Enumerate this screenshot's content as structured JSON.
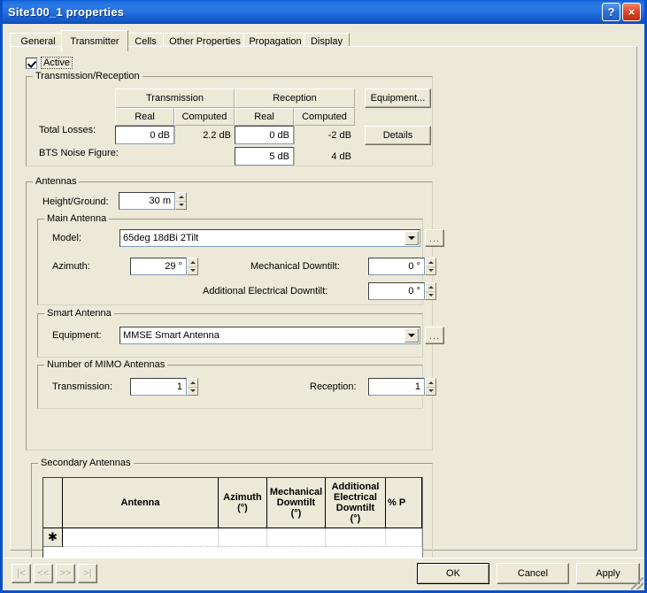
{
  "window": {
    "title": "Site100_1 properties",
    "help_button": "?",
    "close_button": "×"
  },
  "tabs": [
    {
      "label": "General",
      "selected": false
    },
    {
      "label": "Transmitter",
      "selected": true
    },
    {
      "label": "Cells",
      "selected": false
    },
    {
      "label": "Other Properties",
      "selected": false
    },
    {
      "label": "Propagation",
      "selected": false
    },
    {
      "label": "Display",
      "selected": false
    }
  ],
  "active_checkbox": {
    "label": "Active",
    "checked": true
  },
  "transmission_reception": {
    "group_title": "Transmission/Reception",
    "col_group_transmission": "Transmission",
    "col_group_reception": "Reception",
    "sub_real": "Real",
    "sub_computed": "Computed",
    "rows": [
      {
        "label": "Total Losses:",
        "tx_real": "0 dB",
        "tx_computed": "2.2 dB",
        "rx_real": "0 dB",
        "rx_computed": "-2 dB"
      },
      {
        "label": "BTS Noise Figure:",
        "tx_real": "",
        "tx_computed": "",
        "rx_real": "5 dB",
        "rx_computed": "4 dB"
      }
    ],
    "equipment_button": "Equipment...",
    "details_button": "Details"
  },
  "antennas": {
    "group_title": "Antennas",
    "height_label": "Height/Ground:",
    "height_value": "30 m",
    "main_antenna": {
      "group_title": "Main Antenna",
      "model_label": "Model:",
      "model_value": "65deg 18dBi 2Tilt",
      "browse_button": "...",
      "azimuth_label": "Azimuth:",
      "azimuth_value": "29 °",
      "mech_downtilt_label": "Mechanical Downtilt:",
      "mech_downtilt_value": "0 °",
      "elec_downtilt_label": "Additional Electrical Downtilt:",
      "elec_downtilt_value": "0 °"
    },
    "smart_antenna": {
      "group_title": "Smart Antenna",
      "equipment_label": "Equipment:",
      "equipment_value": "MMSE Smart Antenna",
      "browse_button": "..."
    },
    "mimo": {
      "group_title": "Number of MIMO Antennas",
      "transmission_label": "Transmission:",
      "transmission_value": "1",
      "reception_label": "Reception:",
      "reception_value": "1"
    }
  },
  "secondary_antennas": {
    "group_title": "Secondary Antennas",
    "row_marker": "✱",
    "columns": [
      "Antenna",
      "Azimuth\n(°)",
      "Mechanical\nDowntilt\n(°)",
      "Additional\nElectrical\nDowntilt\n(°)",
      "% P"
    ],
    "rows": [
      {
        "antenna": "",
        "azimuth": "",
        "mechanical_downtilt": "",
        "additional_electrical_downtilt": "",
        "percent_power": ""
      }
    ]
  },
  "footer": {
    "nav_first": "|<",
    "nav_prev": "<<",
    "nav_next": ">>",
    "nav_last": ">|",
    "ok": "OK",
    "cancel": "Cancel",
    "apply": "Apply"
  },
  "colors": {
    "title_bar_blue": "#0a5bd3",
    "dialog_face": "#ece9d8",
    "field_white": "#ffffff",
    "close_red": "#c32d12"
  }
}
